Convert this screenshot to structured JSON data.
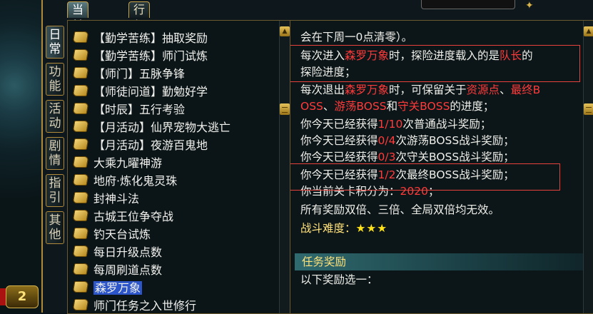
{
  "world": {
    "badge": "2"
  },
  "tabs": [
    {
      "label": "当前任务",
      "active": true
    },
    {
      "label": "行行出状元",
      "active": false
    }
  ],
  "side_tabs": [
    {
      "label": "日常",
      "active": true
    },
    {
      "label": "功能",
      "active": false
    },
    {
      "label": "活动",
      "active": false
    },
    {
      "label": "剧情",
      "active": false
    },
    {
      "label": "指引",
      "active": false
    },
    {
      "label": "其他",
      "active": false
    }
  ],
  "quests": [
    {
      "label": "【勤学苦练】抽取奖励"
    },
    {
      "label": "【勤学苦练】师门试炼"
    },
    {
      "label": "【师门】五脉争锋"
    },
    {
      "label": "【师徒问道】勤勉好学"
    },
    {
      "label": "【时辰】五行考验"
    },
    {
      "label": "【月活动】仙界宠物大逃亡"
    },
    {
      "label": "【月活动】夜游百鬼地"
    },
    {
      "label": "大乘九曜神游"
    },
    {
      "label": "地府·炼化鬼灵珠"
    },
    {
      "label": "封神斗法"
    },
    {
      "label": "古城王位争夺战"
    },
    {
      "label": "钓天台试炼"
    },
    {
      "label": "每日升级点数"
    },
    {
      "label": "每周刷道点数"
    },
    {
      "label": "森罗万象",
      "selected": true
    },
    {
      "label": "师门任务之入世修行"
    }
  ],
  "detail": {
    "l1": "会在下周一0点清零）。",
    "l2a": "每次进入",
    "l2b": "森罗万象",
    "l2c": "时，探险进度载入的是",
    "l2d": "队长",
    "l2e": "的",
    "l3": "探险进度；",
    "l4a": "每次退出",
    "l4b": "森罗万象",
    "l4c": "时，可保留关于",
    "l4d": "资源点",
    "l4e": "、",
    "l4f": "最终B",
    "l5a": "OSS",
    "l5b": "、",
    "l5c": "游荡BOSS",
    "l5d": "和",
    "l5e": "守关BOSS",
    "l5f": "的进度；",
    "l6a": "你今天已经获得",
    "l6b": "1/10",
    "l6c": "次普通战斗奖励；",
    "l7a": "你今天已经获得",
    "l7b": "0/4",
    "l7c": "次游荡BOSS战斗奖励；",
    "l8a": "你今天已经获得",
    "l8b": "0/3",
    "l8c": "次守关BOSS战斗奖励；",
    "l9a": "你今天已经获得",
    "l9b": "1/2",
    "l9c": "次最终BOSS战斗奖励；",
    "l10a": "你当前关卡积分为：",
    "l10b": "2020",
    "l10c": "；",
    "l11": "所有奖励双倍、三倍、全局双倍均无效。",
    "l12a": "战斗难度：",
    "l12b": "★★★",
    "reward_title": "任务奖励",
    "l13": "以下奖励选一："
  },
  "colors": {
    "highlight_red": "#ff3b3b",
    "gold": "#ffe27a",
    "selection": "#2b55c8",
    "annotation_box": "#e8403a"
  }
}
